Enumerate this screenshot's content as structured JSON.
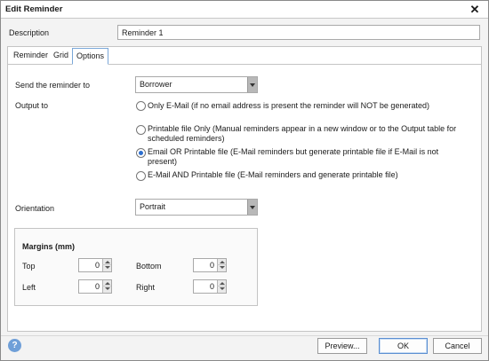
{
  "window": {
    "title": "Edit Reminder",
    "close_glyph": "✕"
  },
  "description": {
    "label": "Description",
    "value": "Reminder 1"
  },
  "tabs": [
    {
      "label": "Reminder",
      "active": false
    },
    {
      "label": "Grid",
      "active": false
    },
    {
      "label": "Options",
      "active": true
    }
  ],
  "options": {
    "send_to": {
      "label": "Send the reminder to",
      "value": "Borrower"
    },
    "output_to": {
      "label": "Output to",
      "choices": [
        {
          "line1": "Only E-Mail (if no email address is present the reminder will NOT be generated)",
          "line2": "",
          "checked": false
        },
        {
          "line1": "Printable file Only (Manual reminders appear in a new window or to the Output table for",
          "line2": "scheduled reminders)",
          "checked": false
        },
        {
          "line1": "Email OR Printable file (E-Mail reminders but generate printable file if E-Mail is not",
          "line2": "present)",
          "checked": true
        },
        {
          "line1": "E-Mail AND Printable file (E-Mail reminders and generate printable file)",
          "line2": "",
          "checked": false
        }
      ]
    },
    "orientation": {
      "label": "Orientation",
      "value": "Portrait"
    },
    "margins": {
      "title": "Margins (mm)",
      "top": {
        "label": "Top",
        "value": "0"
      },
      "bottom": {
        "label": "Bottom",
        "value": "0"
      },
      "left": {
        "label": "Left",
        "value": "0"
      },
      "right": {
        "label": "Right",
        "value": "0"
      }
    }
  },
  "footer": {
    "help_glyph": "?",
    "preview_label": "Preview...",
    "ok_label": "OK",
    "cancel_label": "Cancel"
  },
  "colors": {
    "accent": "#2d6fcf",
    "tab_border": "#7aa7d8",
    "help_icon": "#6f9fd8"
  }
}
